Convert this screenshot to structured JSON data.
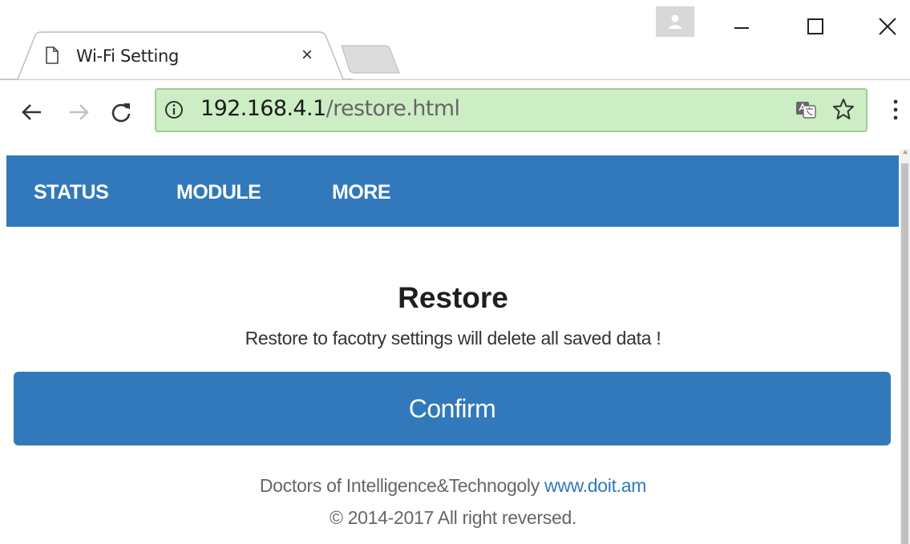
{
  "browser": {
    "tab_title": "Wi-Fi Setting",
    "tab_close": "×",
    "address": {
      "host": "192.168.4.1",
      "path": "/restore.html"
    },
    "icons": {
      "tab": "page-icon",
      "new_tab": "new-tab-icon",
      "profile": "user-icon",
      "minimize": "minimize-icon",
      "maximize": "maximize-icon",
      "close": "close-icon",
      "back": "back-arrow-icon",
      "forward": "forward-arrow-icon",
      "reload": "reload-icon",
      "site_info": "info-icon",
      "translate": "translate-icon",
      "bookmark": "star-icon",
      "menu": "kebab-menu-icon"
    },
    "omnibox_color": "#cdeec4"
  },
  "navbar": {
    "items": [
      {
        "label": "STATUS"
      },
      {
        "label": "MODULE"
      },
      {
        "label": "MORE"
      }
    ],
    "color": "#3179ba"
  },
  "main": {
    "title": "Restore",
    "description": "Restore to facotry settings will delete all saved data !",
    "confirm_label": "Confirm"
  },
  "footer": {
    "company": "Doctors of Intelligence&Technogoly",
    "link": "www.doit.am",
    "copyright": "© 2014-2017 All right reversed."
  }
}
